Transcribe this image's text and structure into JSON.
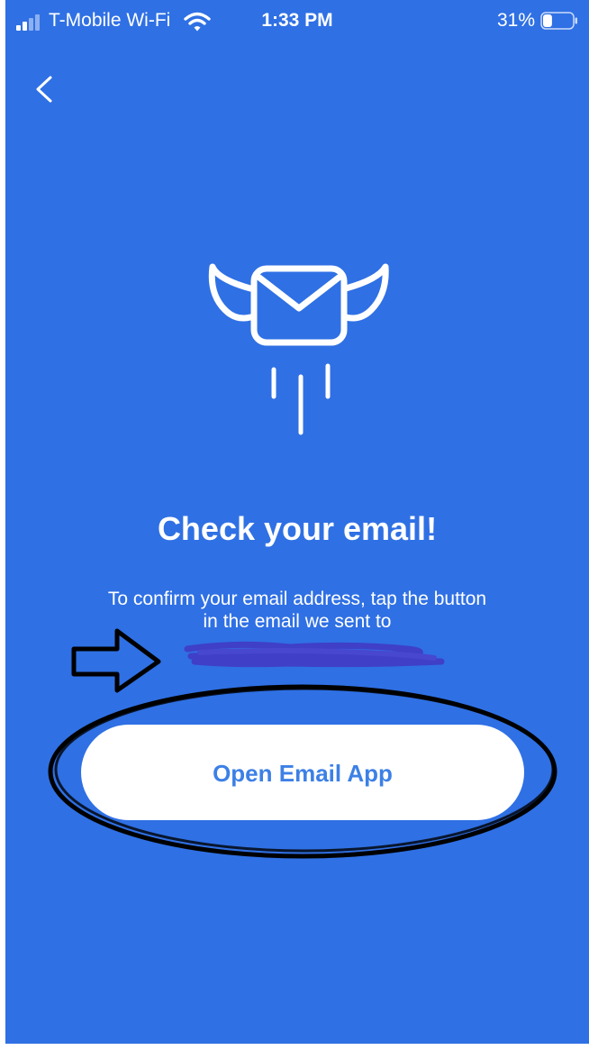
{
  "status_bar": {
    "carrier": "T-Mobile Wi-Fi",
    "time": "1:33 PM",
    "battery_percent": "31%",
    "battery_level": 0.31,
    "signal_bars_active": 2,
    "signal_bars_total": 4,
    "icons": [
      "signal-icon",
      "wifi-icon",
      "battery-icon"
    ]
  },
  "nav": {
    "back_icon": "chevron-left-icon"
  },
  "hero": {
    "icon": "flying-envelope-icon"
  },
  "content": {
    "title": "Check your email!",
    "message_line1": "To confirm your email address, tap the button",
    "message_line2": "in the email we sent to"
  },
  "actions": {
    "open_email_label": "Open Email App"
  },
  "colors": {
    "background": "#2f70e4",
    "button_background": "#ffffff",
    "button_text": "#3d80e6",
    "text": "#ffffff",
    "redaction_scribble": "#3f3fc8",
    "annotation_stroke": "#000000"
  }
}
